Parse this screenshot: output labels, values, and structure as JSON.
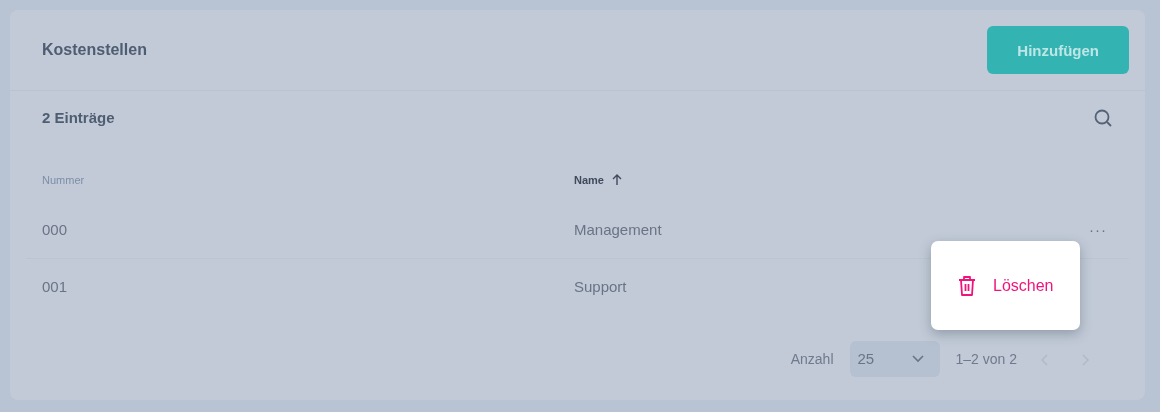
{
  "title": "Kostenstellen",
  "add_button": "Hinzufügen",
  "entry_count": "2 Einträge",
  "columns": [
    {
      "label": "Nummer",
      "sorted": false
    },
    {
      "label": "Name",
      "sorted": true
    }
  ],
  "rows": [
    {
      "nummer": "000",
      "name": "Management",
      "actions": "···",
      "menu_open": true
    },
    {
      "nummer": "001",
      "name": "Support",
      "menu_open": false
    }
  ],
  "context_menu": {
    "items": [
      {
        "kind": "delete",
        "label": "Löschen"
      }
    ]
  },
  "pagination": {
    "label": "Anzahl",
    "page_size": "25",
    "range": "1–2 von 2",
    "prev_disabled": true,
    "next_disabled": true
  }
}
